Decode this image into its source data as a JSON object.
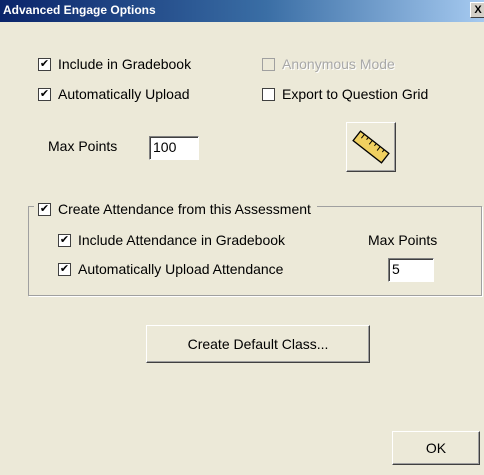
{
  "window": {
    "title": "Advanced Engage Options",
    "close_label": "X"
  },
  "options": {
    "include_gradebook": {
      "label": "Include in Gradebook",
      "checked": true
    },
    "anonymous_mode": {
      "label": "Anonymous Mode",
      "checked": false,
      "disabled": true
    },
    "auto_upload": {
      "label": "Automatically Upload",
      "checked": true
    },
    "export_grid": {
      "label": "Export to Question Grid",
      "checked": false
    }
  },
  "max_points": {
    "label": "Max Points",
    "value": "100"
  },
  "ruler_icon": "ruler-icon",
  "attendance": {
    "group_label": "Create Attendance from this Assessment",
    "group_checked": true,
    "include_gradebook": {
      "label": "Include Attendance in Gradebook",
      "checked": true
    },
    "auto_upload": {
      "label": "Automatically Upload Attendance",
      "checked": true
    },
    "max_points_label": "Max Points",
    "max_points_value": "5"
  },
  "buttons": {
    "create_default_class": "Create Default Class...",
    "ok": "OK"
  },
  "colors": {
    "dialog_bg": "#ece9d8",
    "title_start": "#0a246a",
    "title_end": "#a6caf0",
    "ruler_yellow": "#f0d060"
  }
}
